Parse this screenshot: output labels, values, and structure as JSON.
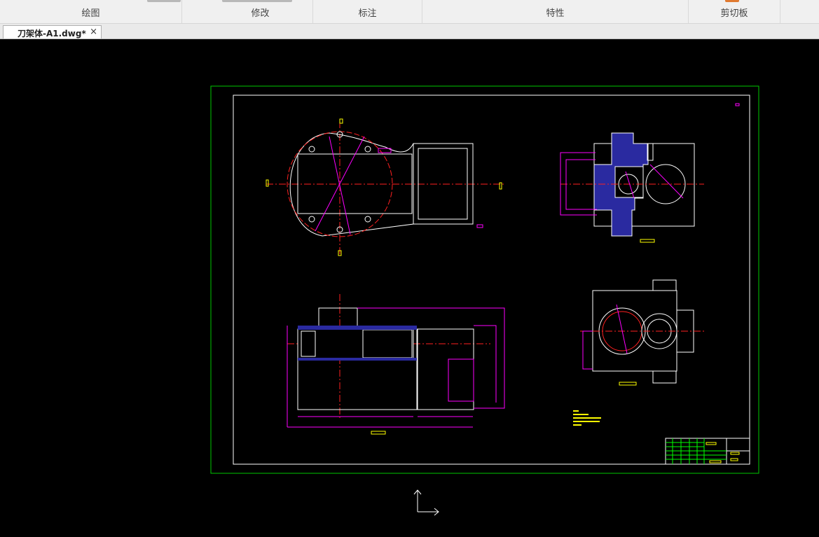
{
  "ribbon": {
    "groups": [
      "绘图",
      "修改",
      "标注",
      "特性",
      "剪切板"
    ]
  },
  "document": {
    "tab_title": "刀架体-A1.dwg*",
    "close_glyph": "×"
  },
  "colors": {
    "ribbon_bg": "#f0f0f0",
    "canvas_bg": "#000000",
    "sheet_border": "#00c800",
    "drawing_lines": "#ffffff",
    "dimensions": "#ff00ff",
    "centerlines": "#ff2020",
    "hatch": "#2a2aa0",
    "notes": "#ffff00",
    "title_block_grid": "#00ff00"
  },
  "icons": [
    "close-icon",
    "ucs-icon"
  ]
}
